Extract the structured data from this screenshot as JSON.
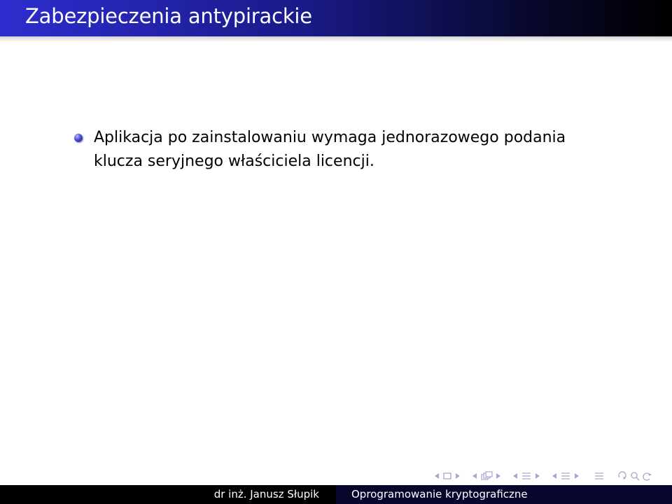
{
  "slide": {
    "title": "Zabezpieczenia antypirackie",
    "bullets": [
      {
        "line1": "Aplikacja po zainstalowaniu wymaga jednorazowego podania",
        "line2": "klucza seryjnego właściciela licencji."
      }
    ]
  },
  "navigation": {
    "icons": [
      "nav-left-arrow",
      "frame-icon",
      "nav-right-arrow",
      "nav-left-arrow",
      "subsection-icon",
      "nav-right-arrow",
      "nav-left-arrow",
      "section-icon",
      "nav-right-arrow",
      "nav-left-arrow",
      "section-icon",
      "nav-right-arrow",
      "align-icon",
      "search-loop-icon"
    ],
    "color": "#a6a6cf"
  },
  "footer": {
    "author": "dr inż. Janusz Słupik",
    "course": "Oprogramowanie kryptograficzne"
  },
  "colors": {
    "title_bar_start": "#2d2dcf",
    "title_bar_end": "#000000",
    "footer_left": "#000000",
    "footer_right": "#07072e"
  }
}
